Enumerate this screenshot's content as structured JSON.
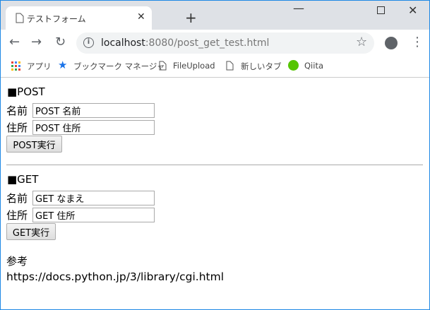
{
  "browser": {
    "tab_title": "テストフォーム",
    "url_host": "localhost",
    "url_rest": ":8080/post_get_test.html",
    "bookmarks": [
      {
        "label": "アプリ",
        "icon": "apps-grid-icon"
      },
      {
        "label": "ブックマーク マネージャ",
        "icon": "star-icon"
      },
      {
        "label": "FileUpload",
        "icon": "page-icon"
      },
      {
        "label": "新しいタブ",
        "icon": "page-icon"
      },
      {
        "label": "Qiita",
        "icon": "qiita-icon"
      }
    ],
    "accent": "#1a73e8"
  },
  "post": {
    "heading": "■POST",
    "name_label": "名前",
    "name_value": "POST 名前",
    "address_label": "住所",
    "address_value": "POST 住所",
    "submit": "POST実行"
  },
  "get": {
    "heading": "■GET",
    "name_label": "名前",
    "name_value": "GET なまえ",
    "address_label": "住所",
    "address_value": "GET 住所",
    "submit": "GET実行"
  },
  "reference": {
    "label": "参考",
    "link": "https://docs.python.jp/3/library/cgi.html"
  }
}
